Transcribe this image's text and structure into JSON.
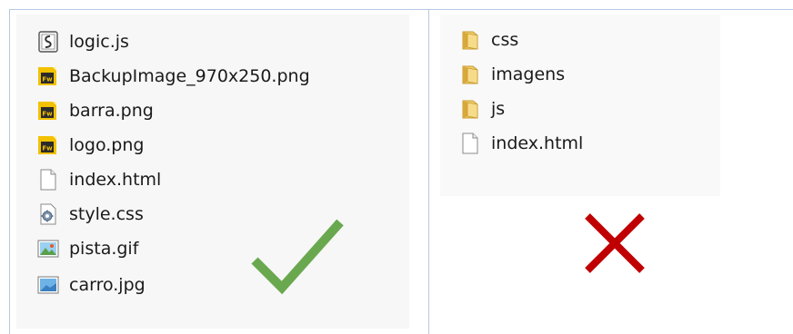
{
  "valid_structure": {
    "files": [
      {
        "name": "logic.js",
        "icon": "js-script-icon"
      },
      {
        "name": "BackupImage_970x250.png",
        "icon": "fireworks-png-icon"
      },
      {
        "name": "barra.png",
        "icon": "fireworks-png-icon"
      },
      {
        "name": "logo.png",
        "icon": "fireworks-png-icon"
      },
      {
        "name": "index.html",
        "icon": "blank-file-icon"
      },
      {
        "name": "style.css",
        "icon": "css-gear-file-icon"
      },
      {
        "name": "pista.gif",
        "icon": "gif-image-icon"
      },
      {
        "name": "carro.jpg",
        "icon": "jpg-image-icon"
      }
    ],
    "indicator": "check-mark-icon",
    "indicator_color": "#6aa84f"
  },
  "invalid_structure": {
    "items": [
      {
        "name": "css",
        "icon": "folder-icon"
      },
      {
        "name": "imagens",
        "icon": "folder-icon"
      },
      {
        "name": "js",
        "icon": "folder-icon"
      },
      {
        "name": "index.html",
        "icon": "blank-file-icon"
      }
    ],
    "indicator": "cross-mark-icon",
    "indicator_color": "#c00000"
  },
  "colors": {
    "divider": "#b5c9e4",
    "folder": "#e8c25a",
    "fireworks_badge": "#f2c200"
  }
}
